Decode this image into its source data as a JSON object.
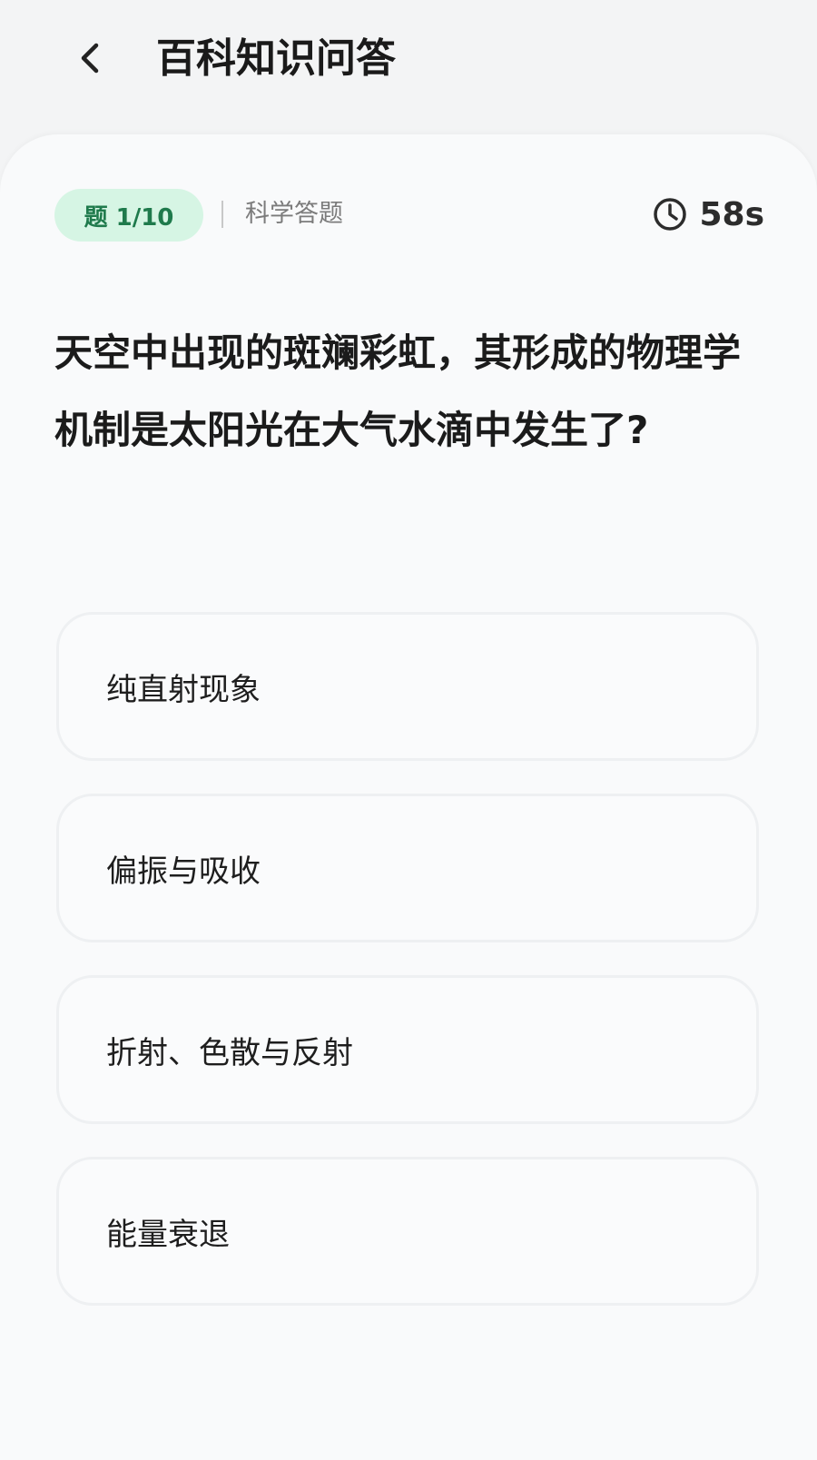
{
  "header": {
    "title": "百科知识问答",
    "back_icon": "chevron-left-icon"
  },
  "quiz": {
    "progress_label": "题 1/10",
    "current": 1,
    "total": 10,
    "category": "科学答题",
    "timer_icon": "clock-icon",
    "timer": "58s",
    "question": "天空中出现的斑斓彩虹，其形成的物理学机制是太阳光在大气水滴中发生了?",
    "options": [
      {
        "label": "纯直射现象"
      },
      {
        "label": "偏振与吸收"
      },
      {
        "label": "折射、色散与反射"
      },
      {
        "label": "能量衰退"
      }
    ]
  },
  "colors": {
    "badge_bg": "#d6f5e4",
    "badge_text": "#1f7a4c",
    "page_bg": "#f3f4f5",
    "card_bg": "#f9fafb"
  }
}
